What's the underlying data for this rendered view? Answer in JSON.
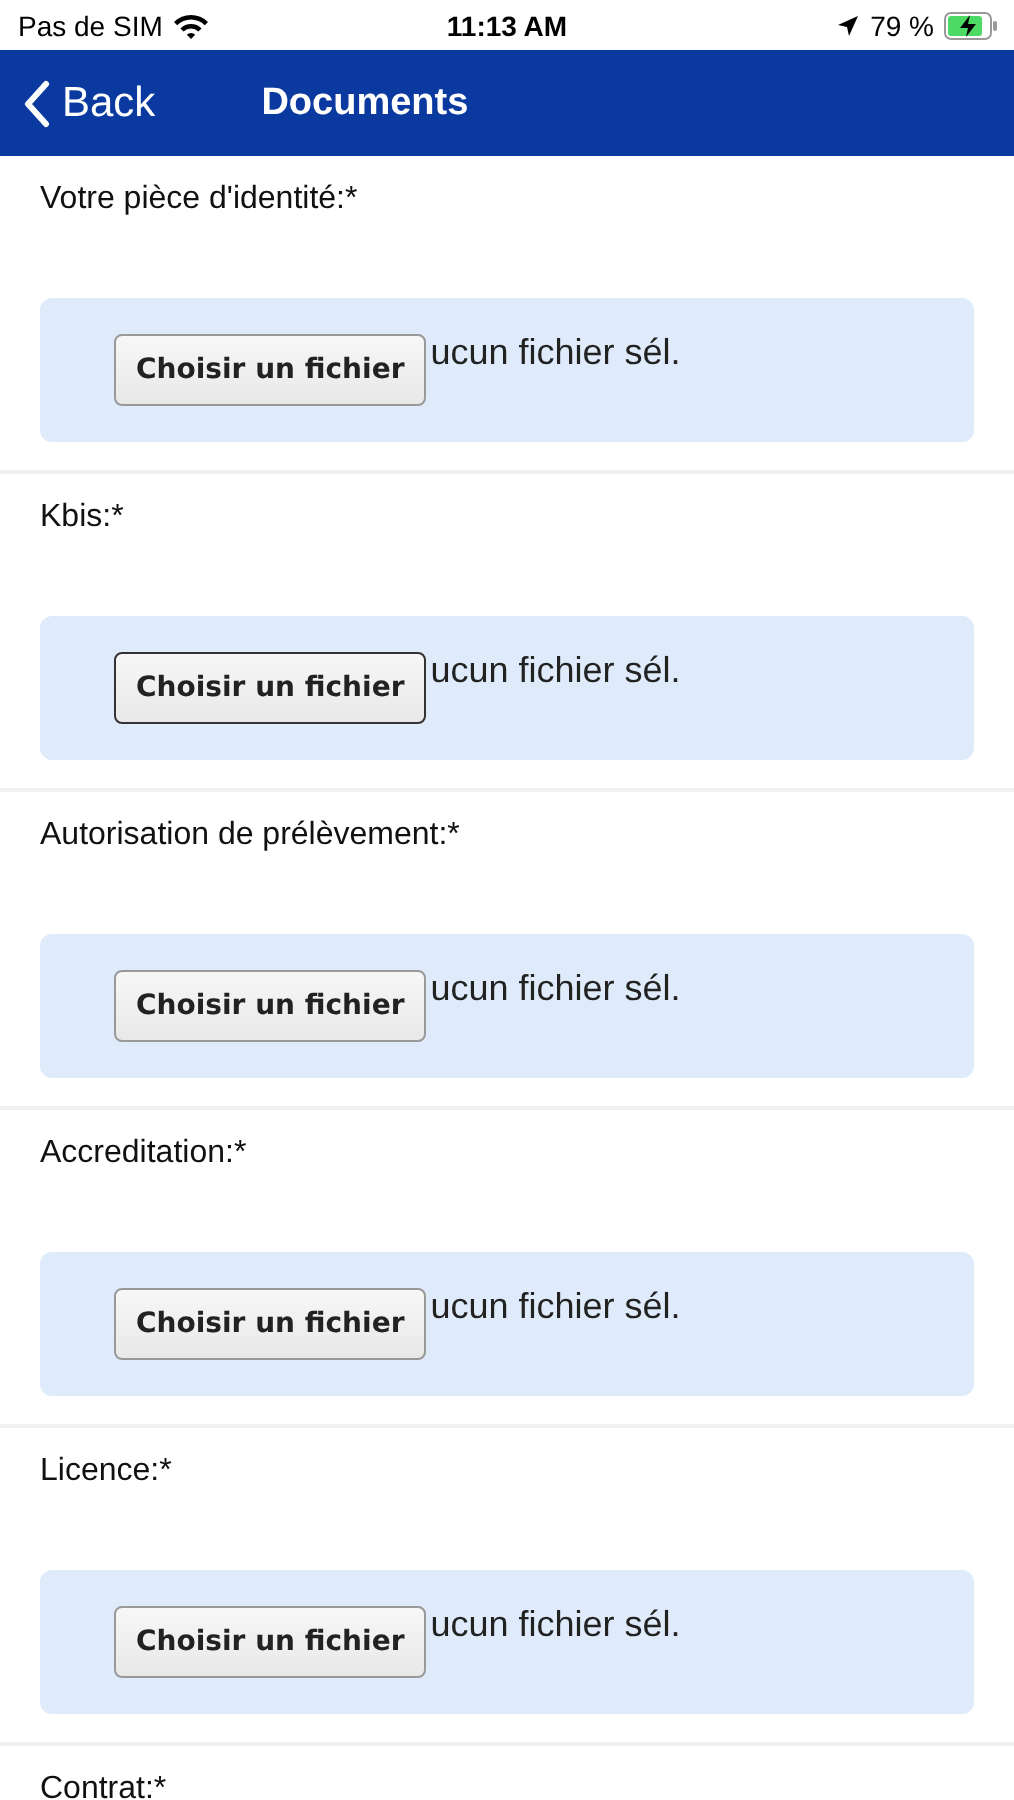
{
  "status_bar": {
    "carrier": "Pas de SIM",
    "time": "11:13 AM",
    "battery": "79 %"
  },
  "nav": {
    "back": "Back",
    "title": "Documents"
  },
  "fields": [
    {
      "label": "Votre pièce d'identité:*",
      "button": "Choisir un fichier",
      "value": "ucun fichier sél.",
      "focused": false
    },
    {
      "label": "Kbis:*",
      "button": "Choisir un fichier",
      "value": "ucun fichier sél.",
      "focused": true
    },
    {
      "label": "Autorisation de prélèvement:*",
      "button": "Choisir un fichier",
      "value": "ucun fichier sél.",
      "focused": false
    },
    {
      "label": "Accreditation:*",
      "button": "Choisir un fichier",
      "value": "ucun fichier sél.",
      "focused": false
    },
    {
      "label": "Licence:*",
      "button": "Choisir un fichier",
      "value": "ucun fichier sél.",
      "focused": false
    },
    {
      "label": "Contrat:*"
    }
  ]
}
